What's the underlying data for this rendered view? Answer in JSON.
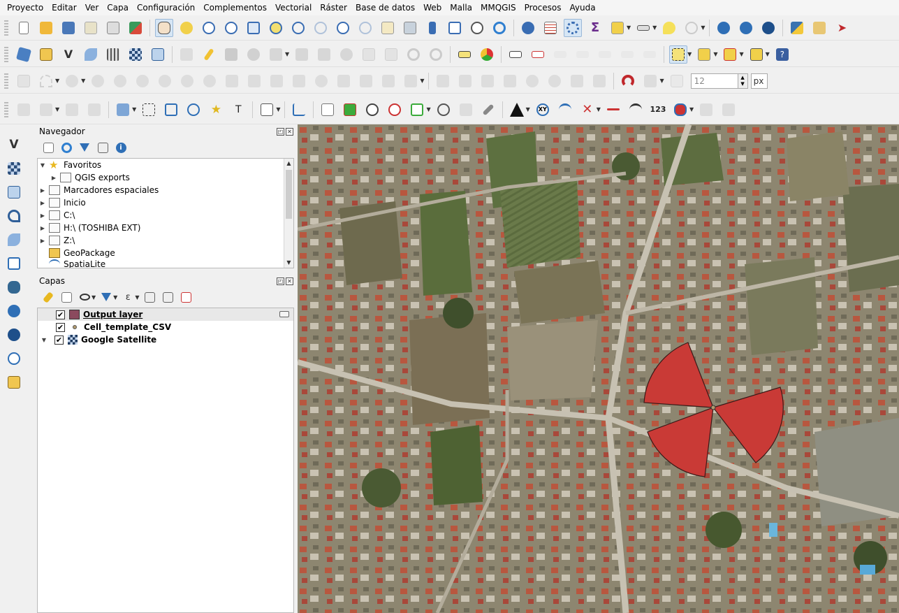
{
  "menubar": {
    "items": [
      "Proyecto",
      "Editar",
      "Ver",
      "Capa",
      "Configuración",
      "Complementos",
      "Vectorial",
      "Ráster",
      "Base de datos",
      "Web",
      "Malla",
      "MMQGIS",
      "Procesos",
      "Ayuda"
    ]
  },
  "toolbar4": {
    "snapping_tolerance": "12",
    "snapping_unit": "px"
  },
  "colors": {
    "output_layer": "#8b4a5e",
    "sector_fill": "#c93a36",
    "accent": "#2f6fb6"
  },
  "navigator": {
    "title": "Navegador",
    "items": [
      {
        "label": "Favoritos",
        "icon": "star-icon",
        "expanded": true
      },
      {
        "label": "QGIS exports",
        "icon": "folder-icon"
      },
      {
        "label": "Marcadores espaciales",
        "icon": "folder-icon"
      },
      {
        "label": "Inicio",
        "icon": "home-folder-icon"
      },
      {
        "label": "C:\\",
        "icon": "folder-icon"
      },
      {
        "label": "H:\\ (TOSHIBA EXT)",
        "icon": "folder-icon"
      },
      {
        "label": "Z:\\",
        "icon": "folder-icon"
      },
      {
        "label": "GeoPackage",
        "icon": "geopackage-icon"
      },
      {
        "label": "SpatiaLite",
        "icon": "spatialite-icon"
      }
    ]
  },
  "layers": {
    "title": "Capas",
    "items": [
      {
        "label": "Output layer",
        "icon": "polygon-symbol-icon",
        "checked": true
      },
      {
        "label": "Cell_template_CSV",
        "icon": "point-symbol-icon",
        "checked": true
      },
      {
        "label": "Google Satellite",
        "icon": "raster-icon",
        "checked": true
      }
    ]
  }
}
